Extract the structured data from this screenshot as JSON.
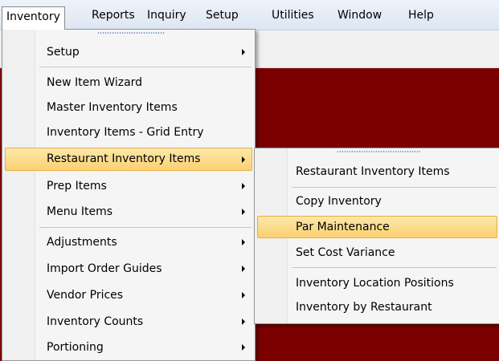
{
  "menubar": {
    "items": [
      "Inventory",
      "Reports",
      "Inquiry",
      "Setup",
      "Utilities",
      "Window",
      "Help"
    ]
  },
  "inventory_menu": {
    "items": [
      {
        "label": "Setup",
        "submenu": true
      },
      {
        "label": "New Item Wizard",
        "submenu": false
      },
      {
        "label": "Master Inventory Items",
        "submenu": false
      },
      {
        "label": "Inventory Items - Grid Entry",
        "submenu": false
      },
      {
        "label": "Restaurant Inventory Items",
        "submenu": true,
        "highlighted": true
      },
      {
        "label": "Prep Items",
        "submenu": true
      },
      {
        "label": "Menu Items",
        "submenu": true
      },
      {
        "label": "Adjustments",
        "submenu": true
      },
      {
        "label": "Import Order Guides",
        "submenu": true
      },
      {
        "label": "Vendor Prices",
        "submenu": true
      },
      {
        "label": "Inventory Counts",
        "submenu": true
      },
      {
        "label": "Portioning",
        "submenu": true
      }
    ]
  },
  "restaurant_submenu": {
    "items": [
      {
        "label": "Restaurant Inventory Items"
      },
      {
        "label": "Copy Inventory"
      },
      {
        "label": "Par Maintenance",
        "highlighted": true
      },
      {
        "label": "Set Cost Variance"
      },
      {
        "label": "Inventory Location Positions"
      },
      {
        "label": "Inventory by Restaurant"
      }
    ]
  },
  "colors": {
    "background": "#7a0000",
    "highlight": "#fbd172",
    "menubar": "#dde6f2"
  }
}
